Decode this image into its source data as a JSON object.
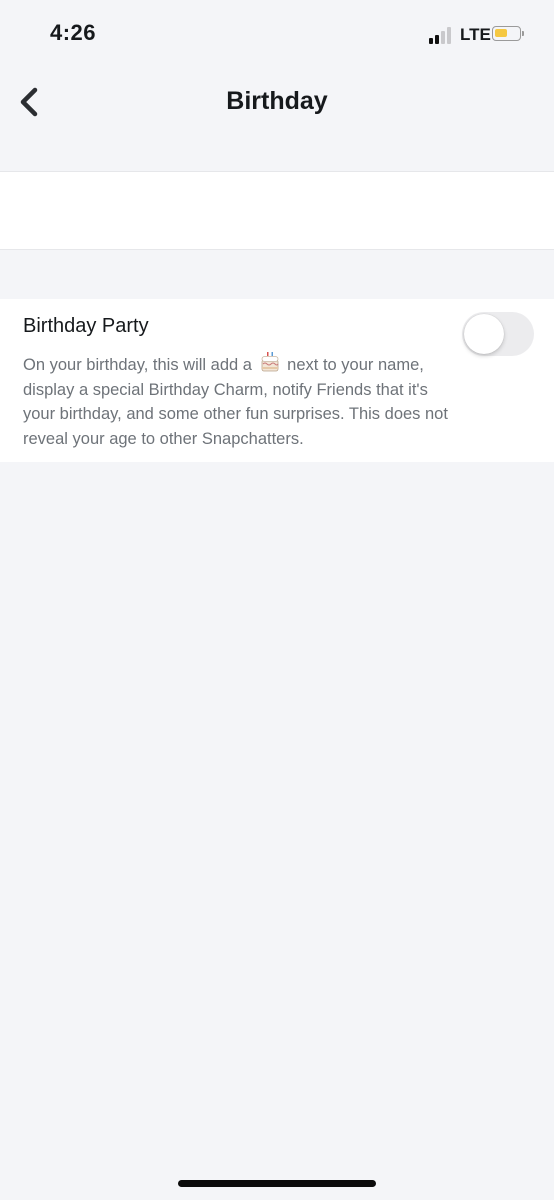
{
  "status_bar": {
    "time": "4:26",
    "network": "LTE",
    "signal_bars_active": 2,
    "signal_bars_total": 4,
    "battery_level": 0.55,
    "battery_color": "#f5c842"
  },
  "header": {
    "title": "Birthday",
    "back_icon": "chevron-left-icon"
  },
  "birthday_party": {
    "title": "Birthday Party",
    "description_before_icon": "On your birthday, this will add a",
    "description_icon": "birthday-cake-icon",
    "description_after_icon": "next to your name, display a special Birthday Charm, notify Friends that it's your birthday, and some other fun surprises. This does not reveal your age to other Snapchatters.",
    "toggle_on": false
  },
  "colors": {
    "background": "#f4f5f8",
    "panel": "#ffffff",
    "title_text": "#16191c",
    "secondary_text": "#6e7379",
    "toggle_off": "#ececee"
  }
}
